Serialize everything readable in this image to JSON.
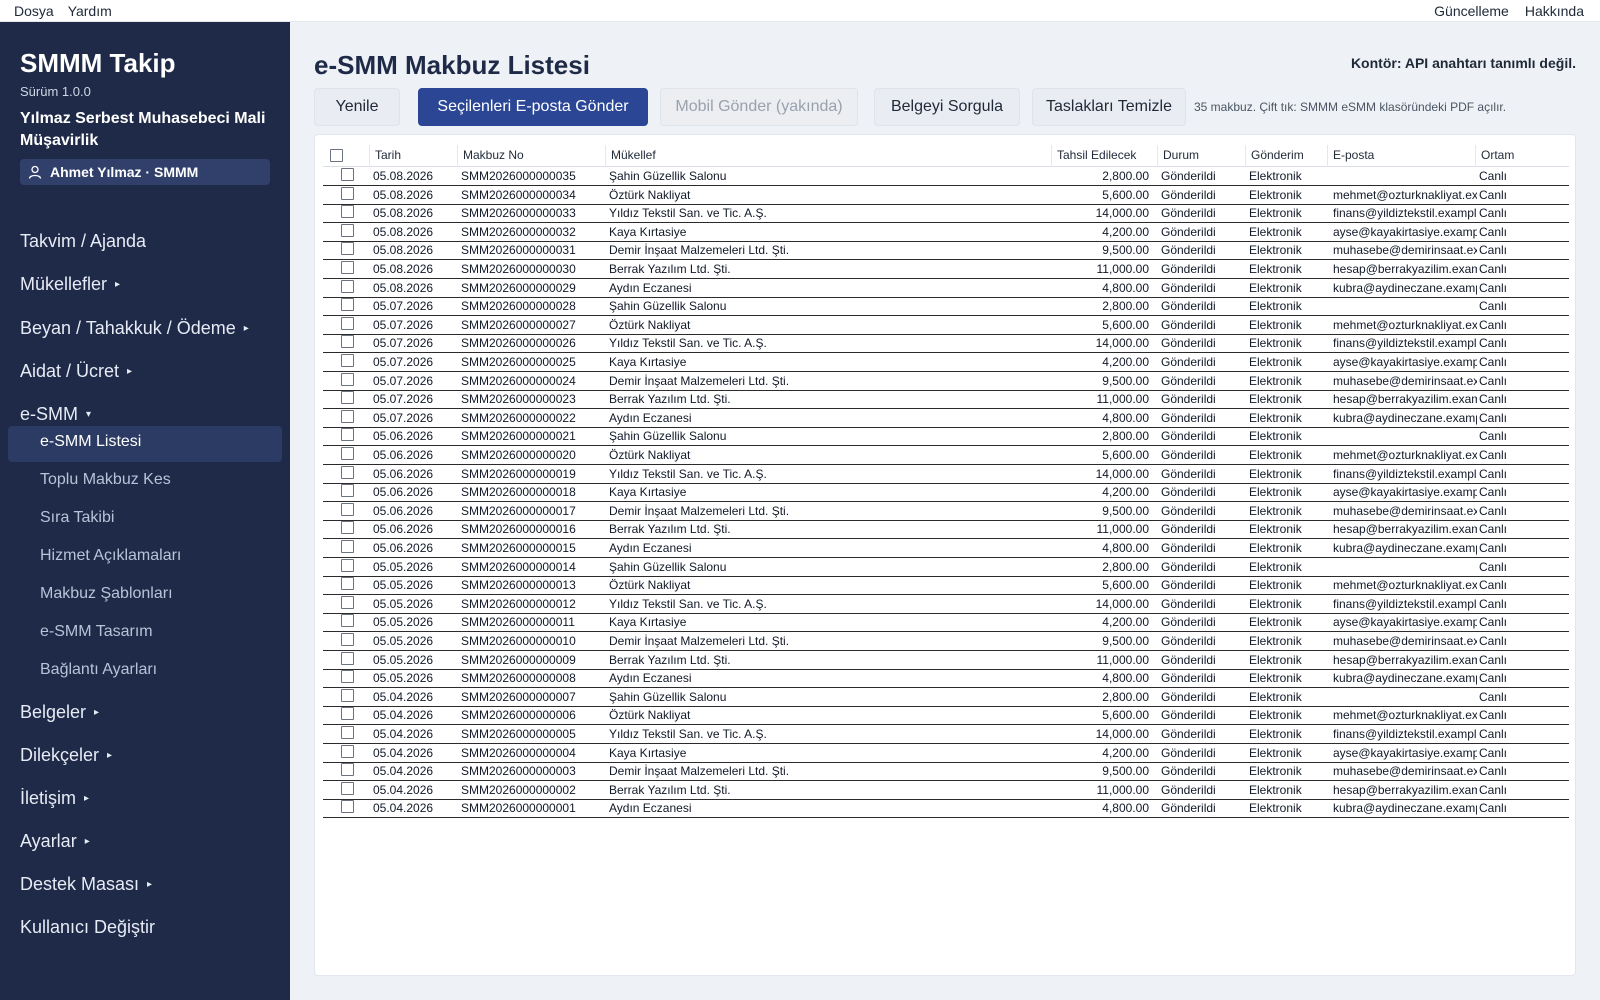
{
  "menubar": {
    "file": "Dosya",
    "help": "Yardım",
    "update": "Güncelleme",
    "about": "Hakkında"
  },
  "sidebar": {
    "app_title": "SMMM Takip",
    "version": "Sürüm 1.0.0",
    "firm": "Yılmaz Serbest Muhasebeci Mali Müşavirlik",
    "user": "Ahmet Yılmaz · SMMM",
    "nav_before": [
      {
        "label": "Takvim / Ajanda",
        "caret": ""
      },
      {
        "label": "Mükellefler",
        "caret": "▸"
      },
      {
        "label": "Beyan / Tahakkuk / Ödeme",
        "caret": "▸"
      },
      {
        "label": "Aidat / Ücret",
        "caret": "▸"
      },
      {
        "label": "e-SMM",
        "caret": "▾"
      }
    ],
    "sub_items": [
      "e-SMM Listesi",
      "Toplu Makbuz Kes",
      "Sıra Takibi",
      "Hizmet Açıklamaları",
      "Makbuz Şablonları",
      "e-SMM Tasarım",
      "Bağlantı Ayarları"
    ],
    "active_sub": "e-SMM Listesi",
    "nav_after": [
      {
        "label": "Belgeler",
        "caret": "▸"
      },
      {
        "label": "Dilekçeler",
        "caret": "▸"
      },
      {
        "label": "İletişim",
        "caret": "▸"
      },
      {
        "label": "Ayarlar",
        "caret": "▸"
      },
      {
        "label": "Destek Masası",
        "caret": "▸"
      },
      {
        "label": "Kullanıcı Değiştir",
        "caret": ""
      }
    ]
  },
  "main": {
    "title": "e-SMM Makbuz Listesi",
    "credit": "Kontör: API anahtarı tanımlı değil.",
    "buttons": {
      "refresh": "Yenile",
      "send_email": "Seçilenleri E-posta Gönder",
      "send_mobile": "Mobil Gönder (yakında)",
      "query": "Belgeyi Sorgula",
      "clean_drafts": "Taslakları Temizle"
    },
    "note": "35 makbuz. Çift tık: SMMM eSMM klasöründeki PDF açılır.",
    "columns": [
      "Tarih",
      "Makbuz No",
      "Mükellef",
      "Tahsil Edilecek",
      "Durum",
      "Gönderim",
      "E-posta",
      "Ortam"
    ]
  },
  "rows": [
    [
      "05.08.2026",
      "SMM2026000000035",
      "Şahin Güzellik Salonu",
      "2,800.00",
      "Gönderildi",
      "Elektronik",
      "",
      "Canlı"
    ],
    [
      "05.08.2026",
      "SMM2026000000034",
      "Öztürk Nakliyat",
      "5,600.00",
      "Gönderildi",
      "Elektronik",
      "mehmet@ozturknakliyat.ex",
      "Canlı"
    ],
    [
      "05.08.2026",
      "SMM2026000000033",
      "Yıldız Tekstil San. ve Tic. A.Ş.",
      "14,000.00",
      "Gönderildi",
      "Elektronik",
      "finans@yildiztekstil.exampl",
      "Canlı"
    ],
    [
      "05.08.2026",
      "SMM2026000000032",
      "Kaya Kırtasiye",
      "4,200.00",
      "Gönderildi",
      "Elektronik",
      "ayse@kayakirtasiye.exampl",
      "Canlı"
    ],
    [
      "05.08.2026",
      "SMM2026000000031",
      "Demir İnşaat Malzemeleri Ltd. Şti.",
      "9,500.00",
      "Gönderildi",
      "Elektronik",
      "muhasebe@demirinsaat.ex",
      "Canlı"
    ],
    [
      "05.08.2026",
      "SMM2026000000030",
      "Berrak Yazılım Ltd. Şti.",
      "11,000.00",
      "Gönderildi",
      "Elektronik",
      "hesap@berrakyazilim.exam",
      "Canlı"
    ],
    [
      "05.08.2026",
      "SMM2026000000029",
      "Aydın Eczanesi",
      "4,800.00",
      "Gönderildi",
      "Elektronik",
      "kubra@aydineczane.examp",
      "Canlı"
    ],
    [
      "05.07.2026",
      "SMM2026000000028",
      "Şahin Güzellik Salonu",
      "2,800.00",
      "Gönderildi",
      "Elektronik",
      "",
      "Canlı"
    ],
    [
      "05.07.2026",
      "SMM2026000000027",
      "Öztürk Nakliyat",
      "5,600.00",
      "Gönderildi",
      "Elektronik",
      "mehmet@ozturknakliyat.ex",
      "Canlı"
    ],
    [
      "05.07.2026",
      "SMM2026000000026",
      "Yıldız Tekstil San. ve Tic. A.Ş.",
      "14,000.00",
      "Gönderildi",
      "Elektronik",
      "finans@yildiztekstil.exampl",
      "Canlı"
    ],
    [
      "05.07.2026",
      "SMM2026000000025",
      "Kaya Kırtasiye",
      "4,200.00",
      "Gönderildi",
      "Elektronik",
      "ayse@kayakirtasiye.exampl",
      "Canlı"
    ],
    [
      "05.07.2026",
      "SMM2026000000024",
      "Demir İnşaat Malzemeleri Ltd. Şti.",
      "9,500.00",
      "Gönderildi",
      "Elektronik",
      "muhasebe@demirinsaat.ex",
      "Canlı"
    ],
    [
      "05.07.2026",
      "SMM2026000000023",
      "Berrak Yazılım Ltd. Şti.",
      "11,000.00",
      "Gönderildi",
      "Elektronik",
      "hesap@berrakyazilim.exam",
      "Canlı"
    ],
    [
      "05.07.2026",
      "SMM2026000000022",
      "Aydın Eczanesi",
      "4,800.00",
      "Gönderildi",
      "Elektronik",
      "kubra@aydineczane.examp",
      "Canlı"
    ],
    [
      "05.06.2026",
      "SMM2026000000021",
      "Şahin Güzellik Salonu",
      "2,800.00",
      "Gönderildi",
      "Elektronik",
      "",
      "Canlı"
    ],
    [
      "05.06.2026",
      "SMM2026000000020",
      "Öztürk Nakliyat",
      "5,600.00",
      "Gönderildi",
      "Elektronik",
      "mehmet@ozturknakliyat.ex",
      "Canlı"
    ],
    [
      "05.06.2026",
      "SMM2026000000019",
      "Yıldız Tekstil San. ve Tic. A.Ş.",
      "14,000.00",
      "Gönderildi",
      "Elektronik",
      "finans@yildiztekstil.exampl",
      "Canlı"
    ],
    [
      "05.06.2026",
      "SMM2026000000018",
      "Kaya Kırtasiye",
      "4,200.00",
      "Gönderildi",
      "Elektronik",
      "ayse@kayakirtasiye.exampl",
      "Canlı"
    ],
    [
      "05.06.2026",
      "SMM2026000000017",
      "Demir İnşaat Malzemeleri Ltd. Şti.",
      "9,500.00",
      "Gönderildi",
      "Elektronik",
      "muhasebe@demirinsaat.ex",
      "Canlı"
    ],
    [
      "05.06.2026",
      "SMM2026000000016",
      "Berrak Yazılım Ltd. Şti.",
      "11,000.00",
      "Gönderildi",
      "Elektronik",
      "hesap@berrakyazilim.exam",
      "Canlı"
    ],
    [
      "05.06.2026",
      "SMM2026000000015",
      "Aydın Eczanesi",
      "4,800.00",
      "Gönderildi",
      "Elektronik",
      "kubra@aydineczane.examp",
      "Canlı"
    ],
    [
      "05.05.2026",
      "SMM2026000000014",
      "Şahin Güzellik Salonu",
      "2,800.00",
      "Gönderildi",
      "Elektronik",
      "",
      "Canlı"
    ],
    [
      "05.05.2026",
      "SMM2026000000013",
      "Öztürk Nakliyat",
      "5,600.00",
      "Gönderildi",
      "Elektronik",
      "mehmet@ozturknakliyat.ex",
      "Canlı"
    ],
    [
      "05.05.2026",
      "SMM2026000000012",
      "Yıldız Tekstil San. ve Tic. A.Ş.",
      "14,000.00",
      "Gönderildi",
      "Elektronik",
      "finans@yildiztekstil.exampl",
      "Canlı"
    ],
    [
      "05.05.2026",
      "SMM2026000000011",
      "Kaya Kırtasiye",
      "4,200.00",
      "Gönderildi",
      "Elektronik",
      "ayse@kayakirtasiye.exampl",
      "Canlı"
    ],
    [
      "05.05.2026",
      "SMM2026000000010",
      "Demir İnşaat Malzemeleri Ltd. Şti.",
      "9,500.00",
      "Gönderildi",
      "Elektronik",
      "muhasebe@demirinsaat.ex",
      "Canlı"
    ],
    [
      "05.05.2026",
      "SMM2026000000009",
      "Berrak Yazılım Ltd. Şti.",
      "11,000.00",
      "Gönderildi",
      "Elektronik",
      "hesap@berrakyazilim.exam",
      "Canlı"
    ],
    [
      "05.05.2026",
      "SMM2026000000008",
      "Aydın Eczanesi",
      "4,800.00",
      "Gönderildi",
      "Elektronik",
      "kubra@aydineczane.examp",
      "Canlı"
    ],
    [
      "05.04.2026",
      "SMM2026000000007",
      "Şahin Güzellik Salonu",
      "2,800.00",
      "Gönderildi",
      "Elektronik",
      "",
      "Canlı"
    ],
    [
      "05.04.2026",
      "SMM2026000000006",
      "Öztürk Nakliyat",
      "5,600.00",
      "Gönderildi",
      "Elektronik",
      "mehmet@ozturknakliyat.ex",
      "Canlı"
    ],
    [
      "05.04.2026",
      "SMM2026000000005",
      "Yıldız Tekstil San. ve Tic. A.Ş.",
      "14,000.00",
      "Gönderildi",
      "Elektronik",
      "finans@yildiztekstil.exampl",
      "Canlı"
    ],
    [
      "05.04.2026",
      "SMM2026000000004",
      "Kaya Kırtasiye",
      "4,200.00",
      "Gönderildi",
      "Elektronik",
      "ayse@kayakirtasiye.exampl",
      "Canlı"
    ],
    [
      "05.04.2026",
      "SMM2026000000003",
      "Demir İnşaat Malzemeleri Ltd. Şti.",
      "9,500.00",
      "Gönderildi",
      "Elektronik",
      "muhasebe@demirinsaat.ex",
      "Canlı"
    ],
    [
      "05.04.2026",
      "SMM2026000000002",
      "Berrak Yazılım Ltd. Şti.",
      "11,000.00",
      "Gönderildi",
      "Elektronik",
      "hesap@berrakyazilim.exam",
      "Canlı"
    ],
    [
      "05.04.2026",
      "SMM2026000000001",
      "Aydın Eczanesi",
      "4,800.00",
      "Gönderildi",
      "Elektronik",
      "kubra@aydineczane.examp",
      "Canlı"
    ]
  ],
  "colors": {
    "sidebar_bg": "#1e2a47",
    "primary": "#2a4695",
    "active_item": "#2c3b63"
  },
  "icons": {
    "user": "user-icon",
    "checkbox": "checkbox-icon",
    "caret_right": "caret-right-icon",
    "caret_down": "caret-down-icon"
  }
}
